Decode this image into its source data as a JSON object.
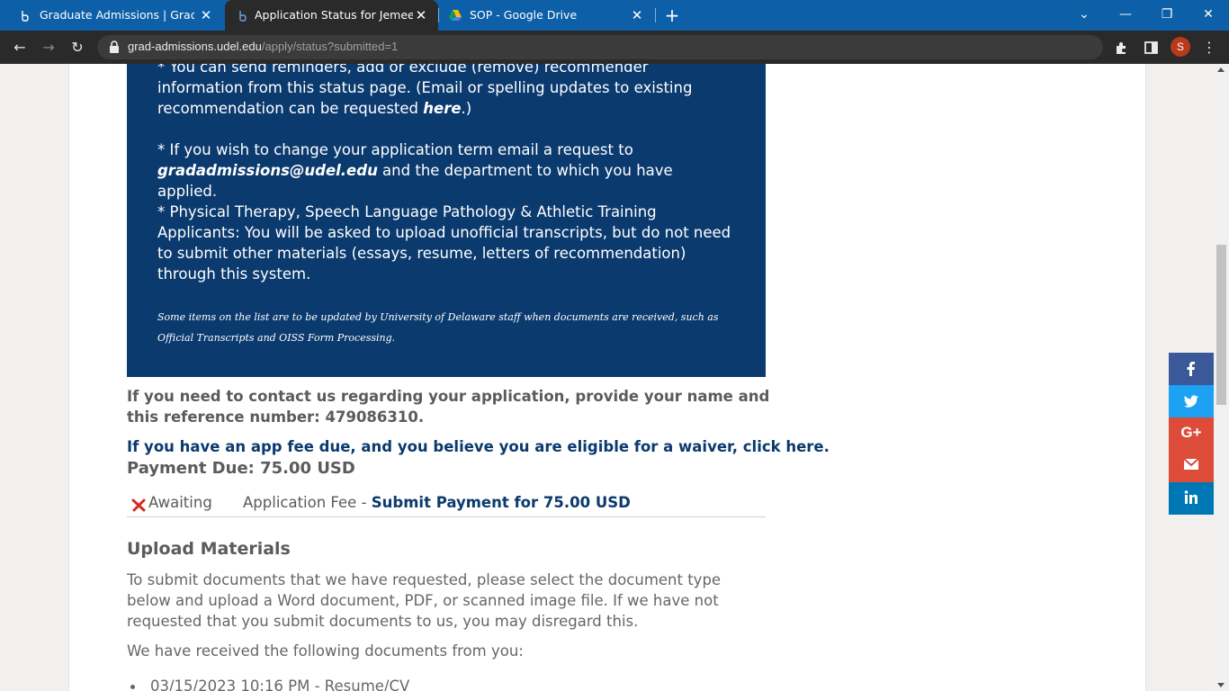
{
  "browser": {
    "tabs": [
      {
        "title": "Graduate Admissions | Graduate",
        "favicon": "udel-icon",
        "active": false
      },
      {
        "title": "Application Status for Jemeel Sac",
        "favicon": "udel-icon",
        "active": true
      },
      {
        "title": "SOP - Google Drive",
        "favicon": "google-drive-icon",
        "active": false
      }
    ],
    "url_host": "grad-admissions.udel.edu",
    "url_path": "/apply/status?submitted=1",
    "profile_initial": "S"
  },
  "info_box": {
    "line_reminders": "* You can send reminders, add or exclude (remove) recommender information from this status page.  (Email or spelling updates to existing recommendation can be requested ",
    "reminders_link": "here",
    "reminders_tail": ".)",
    "term_prefix": "* If you wish to change your application term email a request to ",
    "term_email": "gradadmissions@udel.edu",
    "term_suffix": " and the department to which you have applied.",
    "pt_text": "* Physical Therapy, Speech Language Pathology & Athletic Training Applicants: You will be asked to upload unofficial transcripts, but do not need to submit other materials (essays, resume, letters of recommendation) through this system.",
    "staff_note": "Some items on the list are to be updated by University of Delaware staff when documents are received, such as Official Transcripts and OISS Form Processing."
  },
  "contact_text": "If you need to contact us regarding your application, provide your name and this reference number: 479086310.",
  "waiver_link": "If you have an app fee due, and you believe you are eligible for a waiver, click here.",
  "payment_due": "Payment Due: 75.00 USD",
  "fee_row": {
    "status": " Awaiting",
    "label": "Application Fee - ",
    "link": "Submit Payment for 75.00 USD"
  },
  "upload": {
    "heading": "Upload Materials",
    "instructions": "To submit documents that we have requested, please select the document type below and upload a Word document, PDF, or scanned image file. If we have not requested that you submit documents to us, you may disregard this.",
    "received_intro": "We have received the following documents from you:",
    "documents": [
      "03/15/2023 10:16 PM - Resume/CV"
    ]
  },
  "social": {
    "colors": {
      "facebook": "#3b5998",
      "twitter": "#1da1f2",
      "googleplus": "#dd4b39",
      "email": "#dd4b39",
      "linkedin": "#0077b5"
    },
    "gplus_label": "G+"
  },
  "colors": {
    "tab_bar": "#0d5fa8",
    "info_box": "#0b3a6e",
    "link": "#0b3a6e"
  }
}
